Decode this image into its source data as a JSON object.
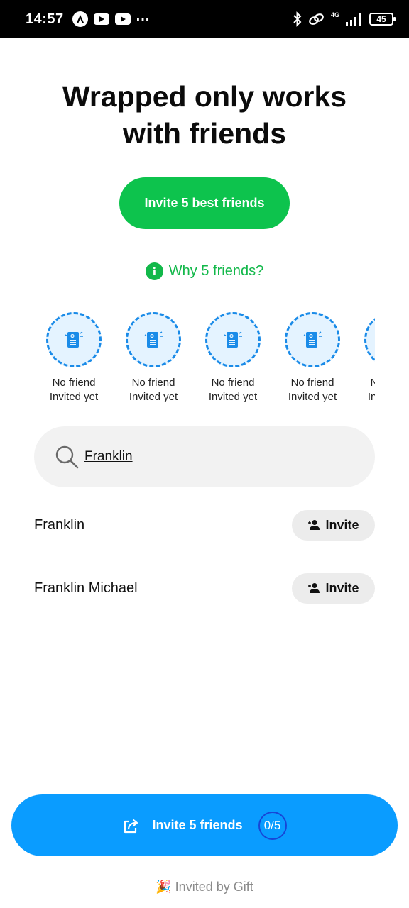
{
  "status_bar": {
    "time": "14:57",
    "network": "4G",
    "battery": "45"
  },
  "heading": {
    "line1": "Wrapped only works",
    "line2": "with friends"
  },
  "invite_best_button": "Invite 5 best friends",
  "why_link": "Why 5 friends?",
  "slots": [
    {
      "line1": "No friend",
      "line2": "Invited yet"
    },
    {
      "line1": "No friend",
      "line2": "Invited yet"
    },
    {
      "line1": "No friend",
      "line2": "Invited yet"
    },
    {
      "line1": "No friend",
      "line2": "Invited yet"
    },
    {
      "line1": "No friend",
      "line2": "Invited yet"
    }
  ],
  "search": {
    "value": "Franklin"
  },
  "results": [
    {
      "name": "Franklin",
      "action": "Invite"
    },
    {
      "name": "Franklin Michael",
      "action": "Invite"
    }
  ],
  "footer": {
    "invite_label": "Invite 5 friends",
    "counter": "0/5",
    "invited_by": "🎉 Invited by Gift"
  },
  "colors": {
    "green": "#0dc34d",
    "blue": "#0a9cff",
    "slot_border": "#1a8be8"
  }
}
